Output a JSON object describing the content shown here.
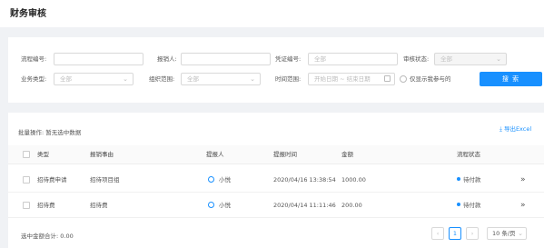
{
  "page_title": "财务审核",
  "filters": {
    "process_no_label": "流程编号:",
    "reimburser_label": "报销人:",
    "voucher_no_label": "凭证编号:",
    "voucher_no_placeholder": "全部",
    "audit_status_label": "审核状态:",
    "audit_status_value": "全部",
    "business_type_label": "业务类型:",
    "business_type_value": "全部",
    "org_scope_label": "组织范围:",
    "org_scope_value": "全部",
    "time_range_label": "时间范围:",
    "time_range_placeholder": "开始日期 ~ 结束日期",
    "only_mine_label": "仅显示我参与的",
    "search_label": "搜 索"
  },
  "list": {
    "batch_label": "批量操作: 暂无选中数据",
    "export_label": "导出Excel",
    "columns": [
      "类型",
      "报销事由",
      "提报人",
      "提报时间",
      "金额",
      "流程状态"
    ],
    "rows": [
      {
        "type": "招待费申请",
        "reason": "招待项目组",
        "submitter": "小悦",
        "time": "2020/04/16 13:38:54",
        "amount": "1000.00",
        "status": "待付款"
      },
      {
        "type": "招待费",
        "reason": "招待费",
        "submitter": "小悦",
        "time": "2020/04/14 11:11:46",
        "amount": "200.00",
        "status": "待付款"
      }
    ],
    "selected_total": "选中金额合计: 0.00",
    "pagination": {
      "prev": "‹",
      "current": "1",
      "next": "›",
      "page_size": "10 条/页"
    }
  },
  "icons": {
    "export": "download-icon",
    "user": "user-icon",
    "next_page_arrow": "chevron-right-icon",
    "row_action": "double-chevron-right-icon"
  },
  "colors": {
    "primary": "#1890ff",
    "background": "#f0f2f5"
  }
}
